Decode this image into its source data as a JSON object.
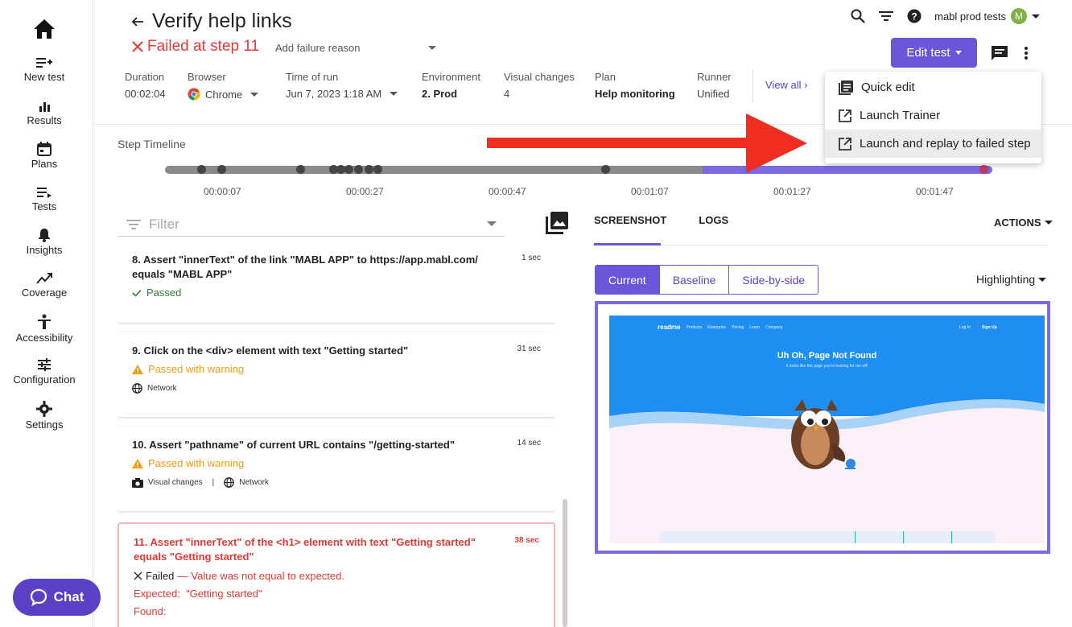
{
  "sidebar": {
    "items": [
      {
        "label": "New test",
        "icon": "new-test-icon"
      },
      {
        "label": "Results",
        "icon": "results-icon"
      },
      {
        "label": "Plans",
        "icon": "plans-icon"
      },
      {
        "label": "Tests",
        "icon": "tests-icon"
      },
      {
        "label": "Insights",
        "icon": "insights-icon"
      },
      {
        "label": "Coverage",
        "icon": "coverage-icon"
      },
      {
        "label": "Accessibility",
        "icon": "accessibility-icon"
      },
      {
        "label": "Configuration",
        "icon": "configuration-icon"
      },
      {
        "label": "Settings",
        "icon": "settings-icon"
      }
    ],
    "chat_label": "Chat"
  },
  "header": {
    "title": "Verify help links",
    "failed_at": "Failed at step 11",
    "failure_reason_placeholder": "Add failure reason",
    "workspace": "mabl prod tests",
    "avatar_initial": "M",
    "edit_label": "Edit test",
    "view_all": "View all",
    "meta": [
      {
        "label": "Duration",
        "value": "00:02:04"
      },
      {
        "label": "Browser",
        "value": "Chrome"
      },
      {
        "label": "Time of run",
        "value": "Jun 7, 2023 1:18 AM"
      },
      {
        "label": "Environment",
        "value": "2. Prod"
      },
      {
        "label": "Visual changes",
        "value": "4"
      },
      {
        "label": "Plan",
        "value": "Help monitoring"
      },
      {
        "label": "Runner",
        "value": "Unified"
      }
    ]
  },
  "dropdown": {
    "items": [
      "Quick edit",
      "Launch Trainer",
      "Launch and replay to failed step"
    ]
  },
  "timeline": {
    "title": "Step Timeline",
    "ticks": [
      "00:00:07",
      "00:00:27",
      "00:00:47",
      "00:01:07",
      "00:01:27",
      "00:01:47"
    ]
  },
  "filter": {
    "placeholder": "Filter"
  },
  "steps": [
    {
      "title": "8. Assert \"innerText\" of the link \"MABL APP\" to https://app.mabl.com/ equals \"MABL APP\"",
      "time": "1 sec",
      "status": "Passed"
    },
    {
      "title": "9. Click on the <div> element with text \"Getting started\"",
      "time": "31 sec",
      "status": "Passed with warning",
      "tags": [
        "Network"
      ]
    },
    {
      "title": "10. Assert \"pathname\" of current URL contains \"/getting-started\"",
      "time": "14 sec",
      "status": "Passed with warning",
      "tags": [
        "Visual changes",
        "Network"
      ]
    },
    {
      "title": "11. Assert \"innerText\" of the <h1> element with text \"Getting started\" equals \"Getting started\"",
      "time": "38 sec",
      "status": "Failed",
      "message": "Value was not equal to expected.",
      "expected_label": "Expected:",
      "expected": "\"Getting started\"",
      "found_label": "Found:"
    }
  ],
  "panel": {
    "tabs": [
      "SCREENSHOT",
      "LOGS"
    ],
    "actions": "ACTIONS",
    "segments": [
      "Current",
      "Baseline",
      "Side-by-side"
    ],
    "highlighting": "Highlighting"
  },
  "screenshot": {
    "brand": "readme",
    "nav": [
      "Products",
      "Enterprise",
      "Pricing",
      "Learn",
      "Company"
    ],
    "login": "Log In",
    "signup": "Sign Up",
    "heading": "Uh Oh, Page Not Found",
    "subheading": "It looks like the page you're looking for ran off!"
  },
  "colors": {
    "accent": "#6a56d8",
    "error": "#e53935",
    "warning": "#f39c12",
    "success": "#2e7d32"
  }
}
